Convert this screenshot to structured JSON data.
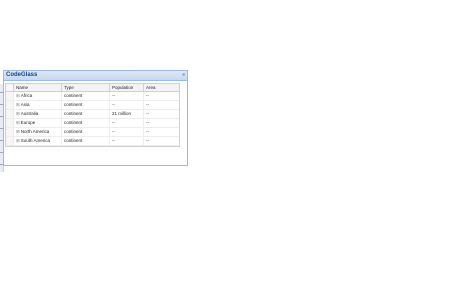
{
  "panel": {
    "title": "CodeGlass",
    "tool_icon": "collapse-icon",
    "tool_glyph": "«"
  },
  "grid": {
    "columns": [
      "Name",
      "Type",
      "Population",
      "Area"
    ],
    "rows": [
      {
        "name": "Africa",
        "type": "continent",
        "population": "--",
        "area": "--"
      },
      {
        "name": "Asia",
        "type": "continent",
        "population": "--",
        "area": "--"
      },
      {
        "name": "Australia",
        "type": "continent",
        "population": "21 million",
        "area": "--"
      },
      {
        "name": "Europe",
        "type": "continent",
        "population": "--",
        "area": "--"
      },
      {
        "name": "North America",
        "type": "continent",
        "population": "--",
        "area": "--"
      },
      {
        "name": "South America",
        "type": "continent",
        "population": "--",
        "area": "--"
      }
    ],
    "expand_glyph": "⊞"
  },
  "colors": {
    "header_text": "#15428b",
    "border": "#99bbe8"
  }
}
